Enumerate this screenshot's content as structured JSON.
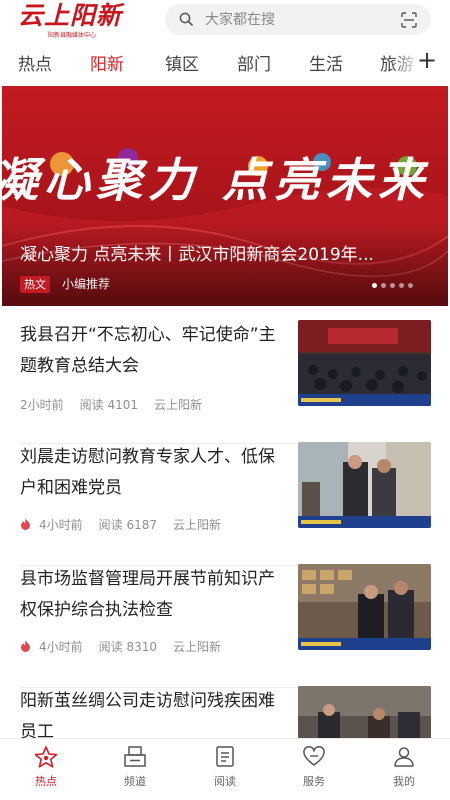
{
  "header": {
    "logo_text": "云上阳新",
    "logo_sub": "阳新县融媒体中心",
    "search_placeholder": "大家都在搜"
  },
  "tabs": [
    "热点",
    "阳新",
    "镇区",
    "部门",
    "生活",
    "旅游"
  ],
  "active_tab": 1,
  "banner": {
    "slogan": "凝心聚力 点亮未来",
    "title": "凝心聚力 点亮未来丨武汉市阳新商会2019年...",
    "tag": "热文",
    "source": "小编推荐",
    "active_dot": 0,
    "dot_count": 5
  },
  "news": [
    {
      "title": "我县召开“不忘初心、牢记使命”主题教育总结大会",
      "time": "2小时前",
      "reads": "阅读 4101",
      "source": "云上阳新",
      "hot": false
    },
    {
      "title": "刘晨走访慰问教育专家人才、低保户和困难党员",
      "time": "4小时前",
      "reads": "阅读 6187",
      "source": "云上阳新",
      "hot": true
    },
    {
      "title": "县市场监督管理局开展节前知识产权保护综合执法检查",
      "time": "4小时前",
      "reads": "阅读 8310",
      "source": "云上阳新",
      "hot": true
    },
    {
      "title": "阳新茧丝绸公司走访慰问残疾困难员工",
      "time": "",
      "reads": "",
      "source": "",
      "hot": false
    }
  ],
  "bottom_nav": [
    {
      "label": "热点",
      "icon": "hot-star-icon"
    },
    {
      "label": "频道",
      "icon": "channel-icon"
    },
    {
      "label": "阅读",
      "icon": "read-icon"
    },
    {
      "label": "服务",
      "icon": "service-icon"
    },
    {
      "label": "我的",
      "icon": "user-icon"
    }
  ],
  "colors": {
    "accent": "#d61f26",
    "banner_red": "#b3151b"
  }
}
